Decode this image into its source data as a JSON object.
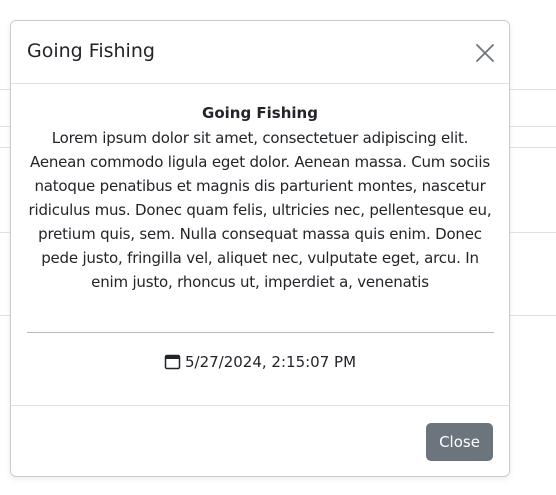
{
  "modal": {
    "title": "Going Fishing",
    "body_title": "Going Fishing",
    "description": "Lorem ipsum dolor sit amet, consectetuer adipiscing elit. Aenean commodo ligula eget dolor. Aenean massa. Cum sociis natoque penatibus et magnis dis parturient montes, nascetur ridiculus mus. Donec quam felis, ultricies nec, pellentesque eu, pretium quis, sem. Nulla consequat massa quis enim. Donec pede justo, fringilla vel, aliquet nec, vulputate eget, arcu. In enim justo, rhoncus ut, imperdiet a, venenatis",
    "datetime": "5/27/2024, 2:15:07 PM",
    "close_button_label": "Close",
    "icons": {
      "close": "close-icon",
      "date": "calendar-icon"
    }
  },
  "colors": {
    "button_bg": "#6c757d",
    "border": "#dee2e6",
    "text": "#212529"
  }
}
